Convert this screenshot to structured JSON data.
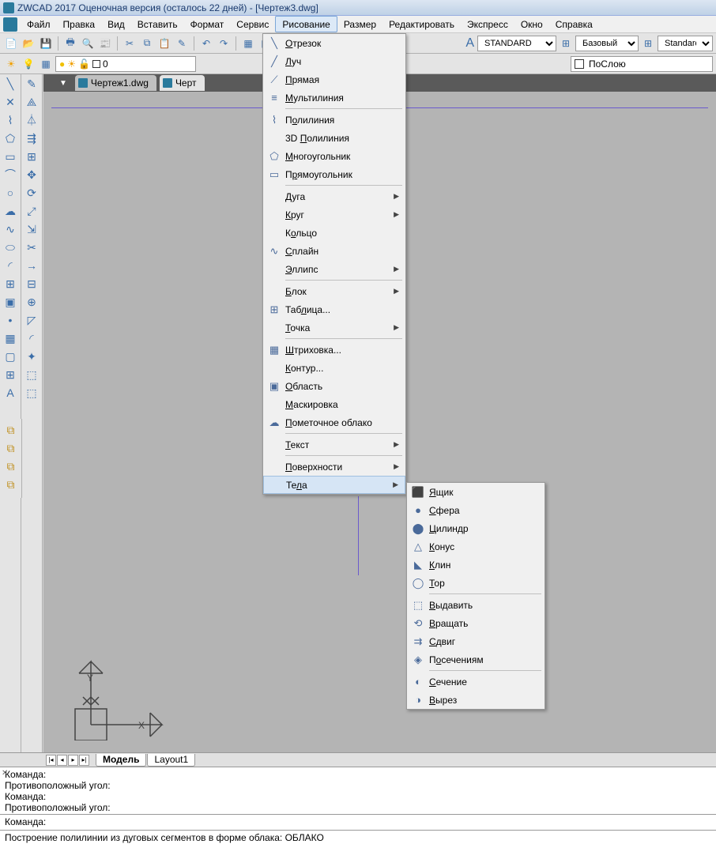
{
  "title": "ZWCAD 2017 Оценочная версия (осталось 22 дней) - [Чертеж3.dwg]",
  "menubar": [
    "Файл",
    "Правка",
    "Вид",
    "Вставить",
    "Формат",
    "Сервис",
    "Рисование",
    "Размер",
    "Редактировать",
    "Экспресс",
    "Окно",
    "Справка"
  ],
  "active_menu_index": 6,
  "toolbar2": {
    "layer_name": "0",
    "style": "STANDARD",
    "dim_style": "Базовый",
    "table_style": "Standard",
    "color": "ПоСлою"
  },
  "file_tabs": [
    {
      "label": "Чертеж1.dwg",
      "active": false
    },
    {
      "label": "Черт",
      "active": true
    }
  ],
  "draw_menu": [
    {
      "icon": "╲",
      "label": "Отрезок",
      "u": 0
    },
    {
      "icon": "╱",
      "label": "Луч",
      "u": 0
    },
    {
      "icon": "⟋",
      "label": "Прямая",
      "u": 0
    },
    {
      "icon": "≡",
      "label": "Мультилиния",
      "u": 0
    },
    {
      "sep": true
    },
    {
      "icon": "⌇",
      "label": "Полилиния",
      "u": 1
    },
    {
      "icon": "",
      "label": "3D Полилиния",
      "u": 3
    },
    {
      "icon": "⬠",
      "label": "Многоугольник",
      "u": 0
    },
    {
      "icon": "▭",
      "label": "Прямоугольник",
      "u": 1
    },
    {
      "sep": true
    },
    {
      "icon": "",
      "label": "Дуга",
      "u": 0,
      "sub": true
    },
    {
      "icon": "",
      "label": "Круг",
      "u": 0,
      "sub": true
    },
    {
      "icon": "",
      "label": "Кольцо",
      "u": 1
    },
    {
      "icon": "∿",
      "label": "Сплайн",
      "u": 0
    },
    {
      "icon": "",
      "label": "Эллипс",
      "u": 0,
      "sub": true
    },
    {
      "sep": true
    },
    {
      "icon": "",
      "label": "Блок",
      "u": 0,
      "sub": true
    },
    {
      "icon": "⊞",
      "label": "Таблица...",
      "u": 3
    },
    {
      "icon": "",
      "label": "Точка",
      "u": 0,
      "sub": true
    },
    {
      "sep": true
    },
    {
      "icon": "▦",
      "label": "Штриховка...",
      "u": 0
    },
    {
      "icon": "",
      "label": "Контур...",
      "u": 0
    },
    {
      "icon": "▣",
      "label": "Область",
      "u": 0
    },
    {
      "icon": "",
      "label": "Маскировка",
      "u": 0
    },
    {
      "icon": "☁",
      "label": "Пометочное облако",
      "u": 0
    },
    {
      "sep": true
    },
    {
      "icon": "",
      "label": "Текст",
      "u": 0,
      "sub": true
    },
    {
      "sep": true
    },
    {
      "icon": "",
      "label": "Поверхности",
      "u": 0,
      "sub": true
    },
    {
      "icon": "",
      "label": "Тела",
      "u": 2,
      "sub": true,
      "hovered": true
    }
  ],
  "solids_submenu": [
    {
      "icon": "⬛",
      "label": "Ящик",
      "u": 0
    },
    {
      "icon": "●",
      "label": "Сфера",
      "u": 0
    },
    {
      "icon": "⬤",
      "label": "Цилиндр",
      "u": 0
    },
    {
      "icon": "△",
      "label": "Конус",
      "u": 0
    },
    {
      "icon": "◣",
      "label": "Клин",
      "u": 0
    },
    {
      "icon": "◯",
      "label": "Тор",
      "u": 0
    },
    {
      "sep": true
    },
    {
      "icon": "⬚",
      "label": "Выдавить",
      "u": 0
    },
    {
      "icon": "⟲",
      "label": "Вращать",
      "u": 0
    },
    {
      "icon": "⇉",
      "label": "Сдвиг",
      "u": 0
    },
    {
      "icon": "◈",
      "label": "Посечениям",
      "u": 1
    },
    {
      "sep": true
    },
    {
      "icon": "◐",
      "label": "Сечение",
      "u": 0
    },
    {
      "icon": "◑",
      "label": "Вырез",
      "u": 0
    }
  ],
  "bottom_tabs": [
    "Модель",
    "Layout1"
  ],
  "command_log": [
    "Команда:",
    "Противоположный угол:",
    "Команда:",
    "Противоположный угол:"
  ],
  "command_prompt": "Команда:",
  "status": "Построение полилинии из дуговых сегментов в форме облака:  ОБЛАКО"
}
